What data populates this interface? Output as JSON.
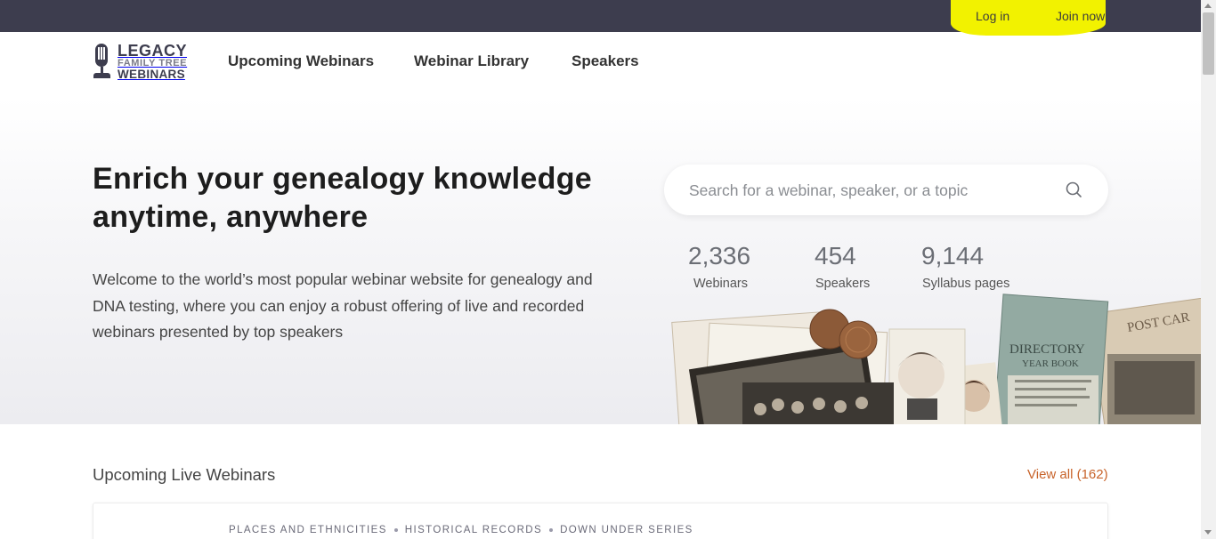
{
  "topbar": {
    "login_label": "Log in",
    "join_label": "Join now",
    "bg_color": "#3d3d4e",
    "highlight_color": "#f2f200"
  },
  "logo": {
    "line1": "LEGACY",
    "line2": "FAMILY TREE",
    "line3": "WEBINARS"
  },
  "nav": {
    "items": [
      {
        "label": "Upcoming Webinars"
      },
      {
        "label": "Webinar Library"
      },
      {
        "label": "Speakers"
      }
    ]
  },
  "hero": {
    "title": "Enrich your genealogy knowledge anytime, anywhere",
    "description": "Welcome to the world’s most popular webinar website for genealogy and DNA testing, where you can enjoy a robust offering of live and recorded webinars presented by top speakers"
  },
  "search": {
    "placeholder": "Search for a webinar, speaker, or a topic",
    "icon": "search-icon"
  },
  "stats": [
    {
      "value": "2,336",
      "label": "Webinars"
    },
    {
      "value": "454",
      "label": "Speakers"
    },
    {
      "value": "9,144",
      "label": "Syllabus pages"
    }
  ],
  "collage": {
    "book_title": "DIRECTORY",
    "book_subtitle": "YEAR BOOK",
    "postcard_text": "POST CAR"
  },
  "upcoming": {
    "title": "Upcoming Live Webinars",
    "view_all": "View all (162)",
    "tags": [
      "PLACES AND ETHNICITIES",
      "HISTORICAL RECORDS",
      "DOWN UNDER SERIES"
    ]
  },
  "colors": {
    "accent": "#c8632a",
    "text_dark": "#1d1d1d"
  }
}
